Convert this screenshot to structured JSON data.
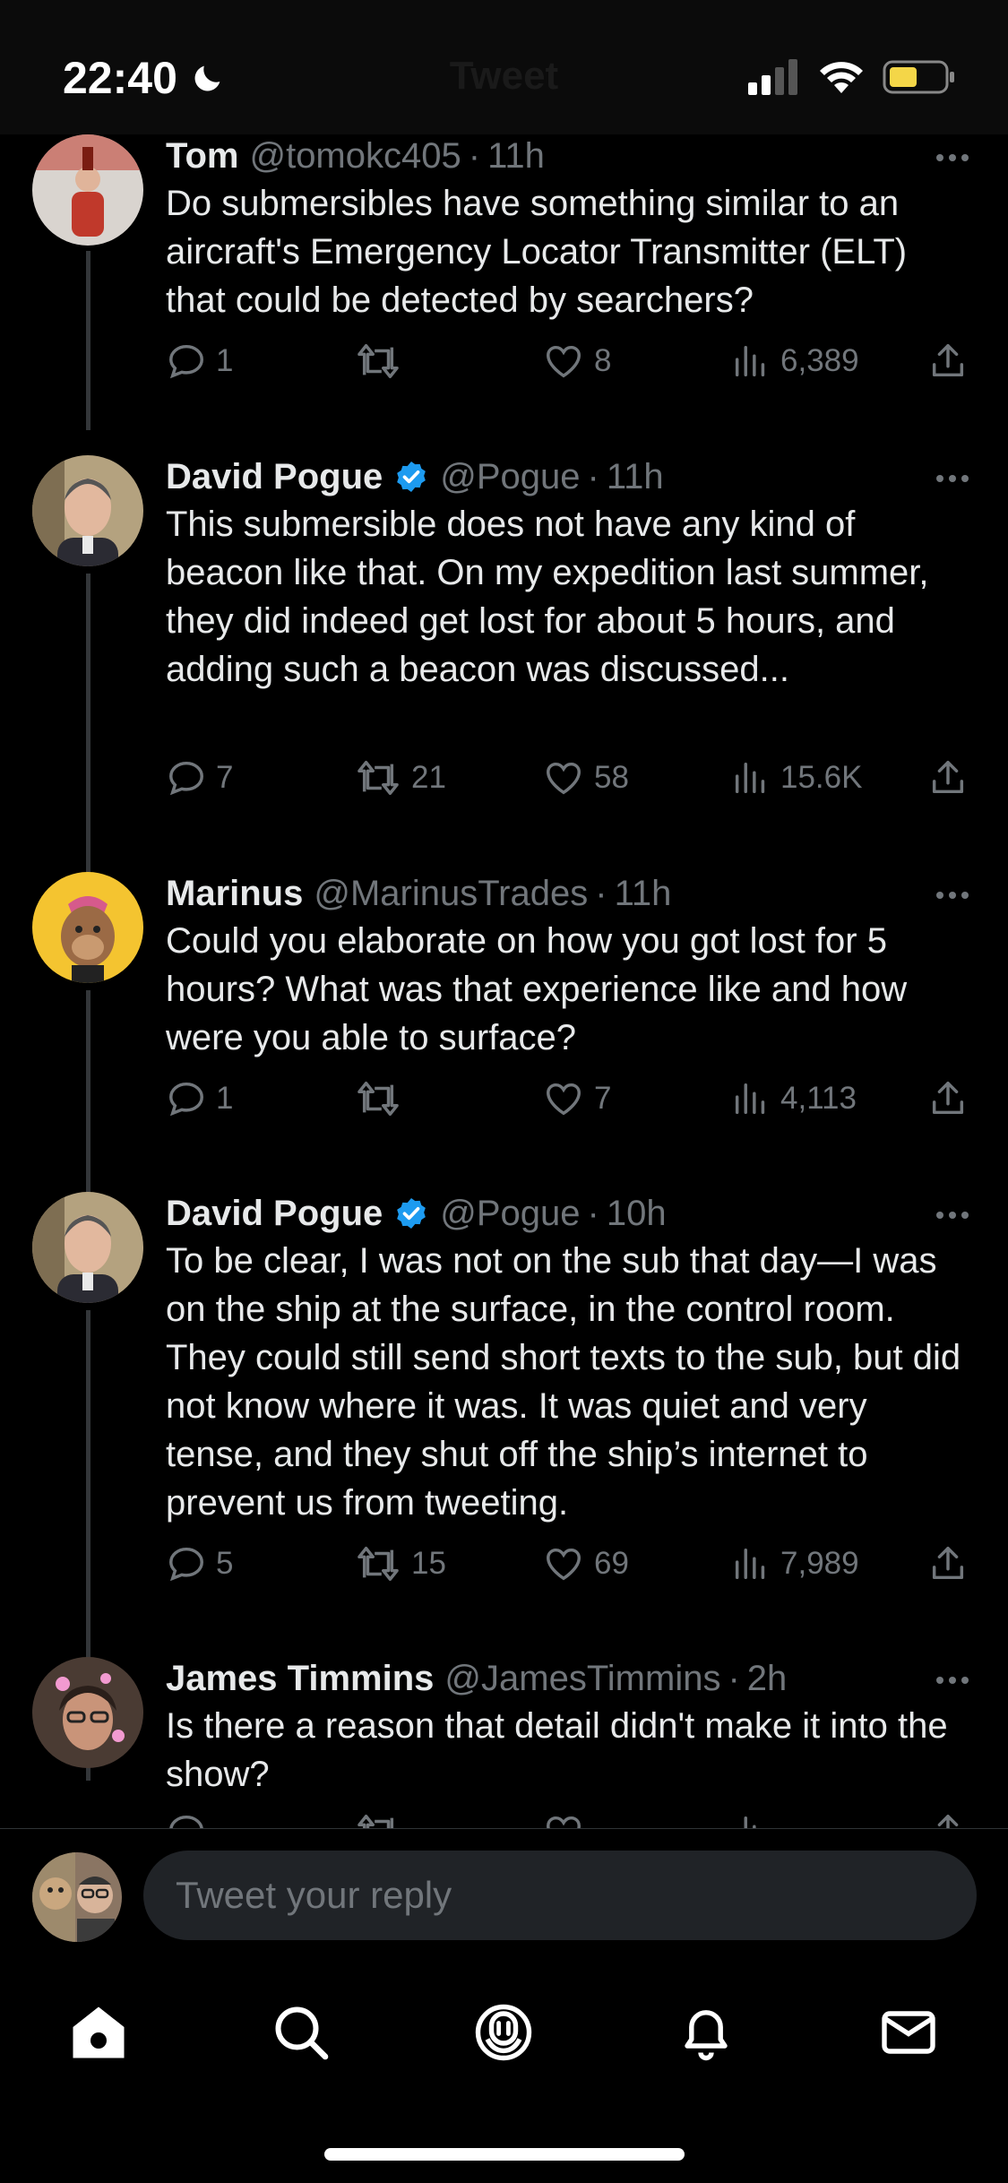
{
  "status": {
    "time": "22:40",
    "header_title": "Tweet"
  },
  "tweets": [
    {
      "name": "Tom",
      "handle": "@tomokc405",
      "time": "11h",
      "verified": false,
      "text": "Do submersibles have something similar to an aircraft's Emergency Locator Transmitter (ELT) that could be detected by searchers?",
      "replies": "1",
      "retweets": "",
      "likes": "8",
      "views": "6,389"
    },
    {
      "name": "David Pogue",
      "handle": "@Pogue",
      "time": "11h",
      "verified": true,
      "text": "This submersible does not have any kind of beacon like that. On my expedition last summer, they did indeed get lost for about 5 hours, and adding such a beacon was discussed...",
      "replies": "7",
      "retweets": "21",
      "likes": "58",
      "views": "15.6K"
    },
    {
      "name": "Marinus",
      "handle": "@MarinusTrades",
      "time": "11h",
      "verified": false,
      "text": "Could you elaborate on how you got lost for 5 hours? What was that experience like and how were you able to surface?",
      "replies": "1",
      "retweets": "",
      "likes": "7",
      "views": "4,113"
    },
    {
      "name": "David Pogue",
      "handle": "@Pogue",
      "time": "10h",
      "verified": true,
      "text": "To be clear, I was not on the sub that day—I was on the ship at the surface, in the control room. They could still send short texts to the sub, but did not know where it was. It was quiet and very tense, and they shut off the ship’s internet to prevent us from tweeting.",
      "replies": "5",
      "retweets": "15",
      "likes": "69",
      "views": "7,989"
    },
    {
      "name": "James Timmins",
      "handle": "@JamesTimmins",
      "time": "2h",
      "verified": false,
      "text": "Is there a reason that detail didn't make it into the show?",
      "replies": "",
      "retweets": "",
      "likes": "",
      "views": ""
    }
  ],
  "reply_bar": {
    "placeholder": "Tweet your reply"
  },
  "colors": {
    "accent": "#1d9bf0",
    "muted": "#71767b",
    "text": "#e7e9ea",
    "background": "#000000"
  },
  "icons": [
    "reply-icon",
    "retweet-icon",
    "like-icon",
    "views-icon",
    "share-icon",
    "more-icon",
    "verified-icon",
    "home-icon",
    "search-icon",
    "spaces-icon",
    "notifications-icon",
    "messages-icon"
  ]
}
